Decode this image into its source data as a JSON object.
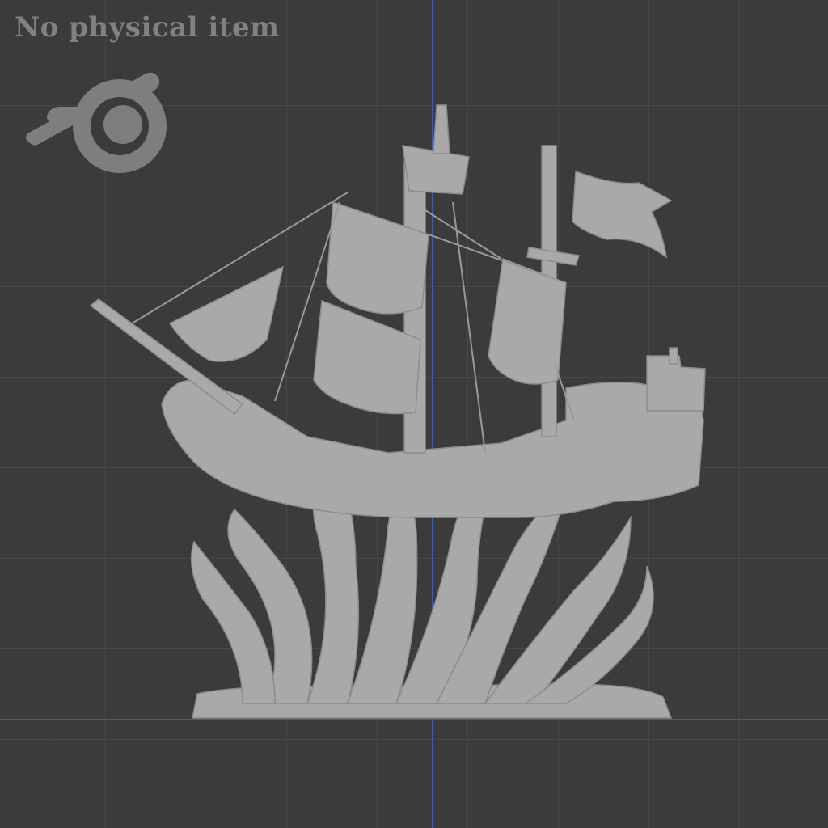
{
  "app": {
    "name": "Blender 3D viewport"
  },
  "overlay": {
    "watermark_text": "No physical item"
  },
  "icons": {
    "logo": "blender-logo-icon"
  },
  "colors": {
    "background": "#3b3b3b",
    "grid_line": "#505050",
    "x_axis": "#a13b47",
    "y_axis": "#3f5fa3",
    "model": "#a9a9a9",
    "logo": "#8a8a8a"
  },
  "model": {
    "name": "ghost-ship-on-tentacles"
  }
}
